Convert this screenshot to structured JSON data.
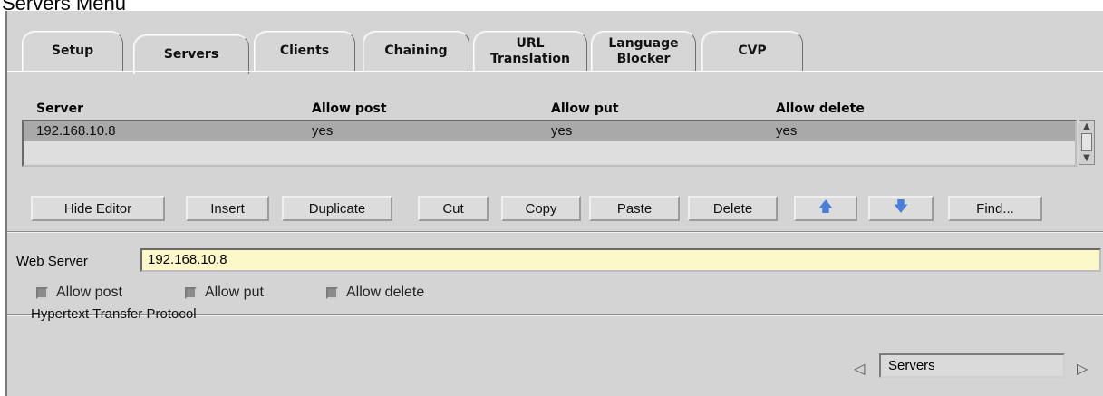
{
  "caption": "Servers Menu",
  "tabs": [
    {
      "label": "Setup"
    },
    {
      "label": "Servers"
    },
    {
      "label": "Clients"
    },
    {
      "label": "Chaining"
    },
    {
      "label": "URL Translation"
    },
    {
      "label": "Language Blocker"
    },
    {
      "label": "CVP"
    }
  ],
  "active_tab": "Servers",
  "table": {
    "headers": [
      "Server",
      "Allow post",
      "Allow put",
      "Allow delete"
    ],
    "rows": [
      [
        "192.168.10.8",
        "yes",
        "yes",
        "yes"
      ]
    ]
  },
  "buttons": {
    "hide_editor": "Hide Editor",
    "insert": "Insert",
    "duplicate": "Duplicate",
    "cut": "Cut",
    "copy": "Copy",
    "paste": "Paste",
    "delete": "Delete",
    "move_up": "arrow-up-icon",
    "move_down": "arrow-down-icon",
    "find": "Find..."
  },
  "editor": {
    "label": "Web Server",
    "value": "192.168.10.8",
    "checkboxes": [
      {
        "label": "Allow post",
        "checked": false
      },
      {
        "label": "Allow put",
        "checked": false
      },
      {
        "label": "Allow delete",
        "checked": false
      }
    ]
  },
  "status": {
    "text": "Hypertext Transfer Protocol",
    "nav_value": "Servers"
  },
  "colors": {
    "input_bg": "#fdf8c9",
    "selected_row": "#a9a9a9",
    "arrow_blue": "#4a7fd8"
  }
}
